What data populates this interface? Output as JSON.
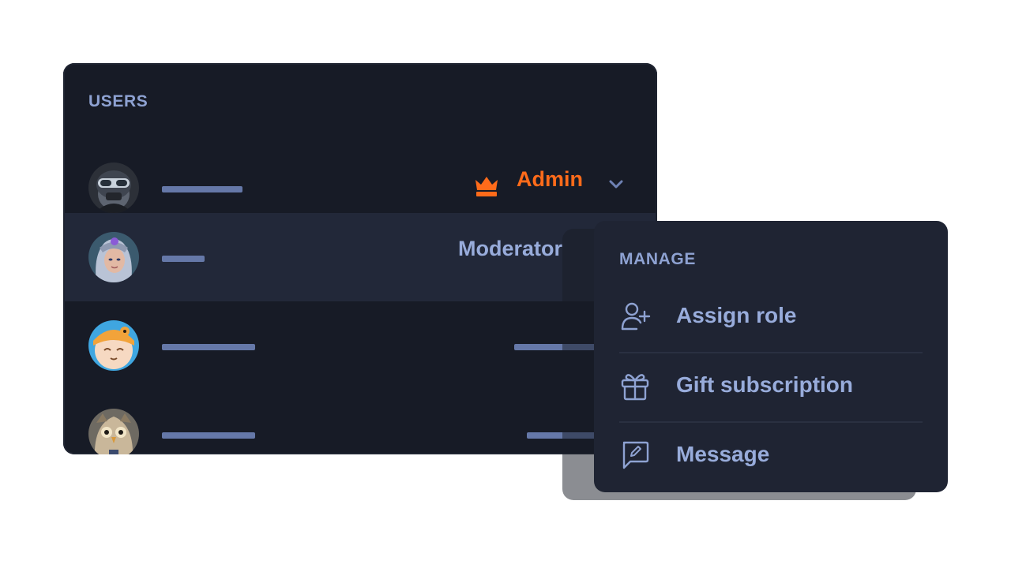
{
  "users_panel": {
    "title": "USERS",
    "rows": [
      {
        "avatar": "soldier-avatar",
        "role": "Admin",
        "role_icon": "crown-icon"
      },
      {
        "avatar": "warrior-avatar",
        "role": "Moderator"
      },
      {
        "avatar": "cat-avatar",
        "role": ""
      },
      {
        "avatar": "owl-avatar",
        "role": ""
      }
    ]
  },
  "manage_menu": {
    "title": "MANAGE",
    "items": [
      {
        "label": "Assign role",
        "icon": "user-plus-icon"
      },
      {
        "label": "Gift subscription",
        "icon": "gift-icon"
      },
      {
        "label": "Message",
        "icon": "message-edit-icon"
      }
    ]
  },
  "colors": {
    "panel_bg": "#171b26",
    "row_highlight": "#222839",
    "menu_bg": "#1f2433",
    "accent": "#ff6b1a",
    "muted_text": "#8ea2d2",
    "placeholder_bar": "#6578a8"
  }
}
